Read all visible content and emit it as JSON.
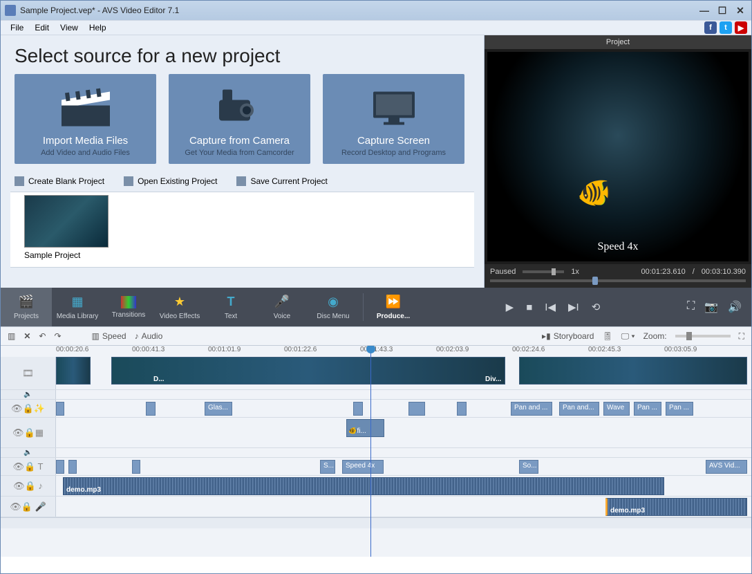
{
  "window": {
    "title": "Sample Project.vep* - AVS Video Editor 7.1"
  },
  "menu": {
    "file": "File",
    "edit": "Edit",
    "view": "View",
    "help": "Help"
  },
  "heading": "Select source for a new project",
  "sources": {
    "import": {
      "title": "Import Media Files",
      "sub": "Add Video and Audio Files"
    },
    "capture": {
      "title": "Capture from Camera",
      "sub": "Get Your Media from Camcorder"
    },
    "screen": {
      "title": "Capture Screen",
      "sub": "Record Desktop and Programs"
    }
  },
  "projlinks": {
    "blank": "Create Blank Project",
    "open": "Open Existing Project",
    "save": "Save Current Project"
  },
  "thumb": {
    "label": "Sample Project"
  },
  "preview": {
    "header": "Project",
    "speed_overlay": "Speed 4x",
    "status": "Paused",
    "speed": "1x",
    "time_cur": "00:01:23.610",
    "time_sep": "/",
    "time_tot": "00:03:10.390"
  },
  "tabs": {
    "projects": "Projects",
    "media": "Media Library",
    "trans": "Transitions",
    "fx": "Video Effects",
    "text": "Text",
    "voice": "Voice",
    "disc": "Disc Menu",
    "produce": "Produce..."
  },
  "subbar": {
    "speed": "Speed",
    "audio": "Audio",
    "storyboard": "Storyboard",
    "zoom": "Zoom:"
  },
  "ruler": [
    "00:00:20.6",
    "00:00:41.3",
    "00:01:01.9",
    "00:01:22.6",
    "00:01:43.3",
    "00:02:03.9",
    "00:02:24.6",
    "00:02:45.3",
    "00:03:05.9"
  ],
  "clips": {
    "d1": "D...",
    "div": "Div...",
    "glass": "Glas...",
    "pan1": "Pan and ...",
    "pan2": "Pan and...",
    "wave": "Wave",
    "pan3": "Pan ...",
    "pan4": "Pan ...",
    "fish": "fi...",
    "s": "S...",
    "speed4x": "Speed 4x",
    "so": "So...",
    "avsvid": "AVS Vid...",
    "demo": "demo.mp3",
    "demo2": "demo.mp3"
  }
}
